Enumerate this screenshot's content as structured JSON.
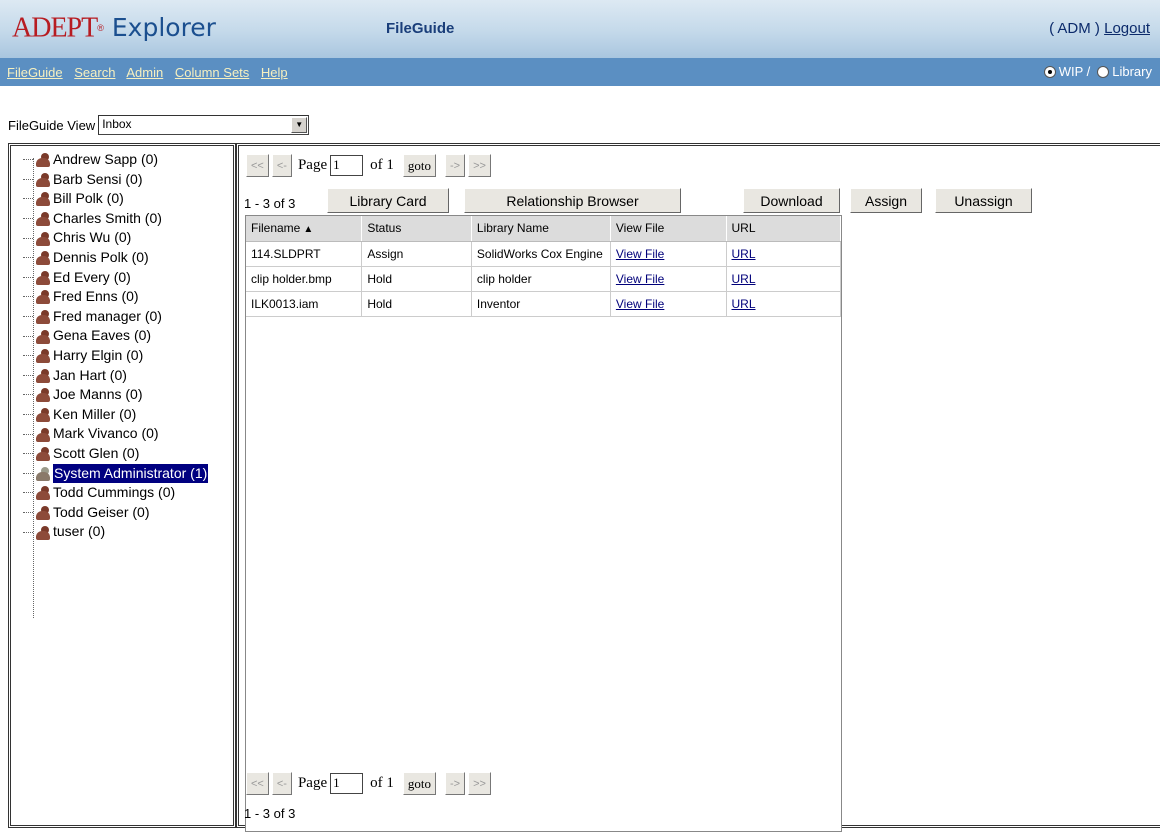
{
  "header": {
    "brand": "ADEPT",
    "trademark": "®",
    "product": "Explorer",
    "page_title": "FileGuide",
    "user_open": "( ",
    "user": "ADM",
    "user_close": " )",
    "logout": "Logout"
  },
  "menu": {
    "items": [
      "FileGuide",
      "Search",
      "Admin",
      "Column Sets",
      "Help"
    ],
    "mode_wip": "WIP /",
    "mode_library": "Library",
    "selected_mode": "WIP"
  },
  "view": {
    "label": "FileGuide View",
    "selected": "Inbox"
  },
  "users": [
    "Andrew Sapp (0)",
    "Barb Sensi (0)",
    "Bill Polk (0)",
    "Charles Smith (0)",
    "Chris Wu (0)",
    "Dennis Polk (0)",
    "Ed Every (0)",
    "Fred Enns (0)",
    "Fred manager (0)",
    "Gena Eaves (0)",
    "Harry Elgin (0)",
    "Jan Hart (0)",
    "Joe Manns (0)",
    "Ken Miller (0)",
    "Mark Vivanco (0)",
    "Scott Glen (0)",
    "System Administrator (1)",
    "Todd Cummings (0)",
    "Todd Geiser (0)",
    "tuser (0)"
  ],
  "selected_user": "System Administrator (1)",
  "pager": {
    "first": "<<",
    "prev": "<-",
    "page_label": "Page",
    "page_value": "1",
    "of_label": "of 1",
    "goto": "goto",
    "next": "->",
    "last": ">>",
    "count": "1 - 3 of 3"
  },
  "actions": {
    "library_card": "Library Card",
    "relationship_browser": "Relationship Browser",
    "download": "Download",
    "assign": "Assign",
    "unassign": "Unassign"
  },
  "table": {
    "columns": [
      "Filename",
      "Status",
      "Library Name",
      "View File",
      "URL"
    ],
    "sorted_column": "Filename",
    "rows": [
      [
        "114.SLDPRT",
        "Assign",
        "SolidWorks Cox Engine",
        "View File",
        "URL"
      ],
      [
        "clip holder.bmp",
        "Hold",
        "clip holder",
        "View File",
        "URL"
      ],
      [
        "ILK0013.iam",
        "Hold",
        "Inventor",
        "View File",
        "URL"
      ]
    ]
  },
  "colors": {
    "menu_bar": "#5b8fc2",
    "menu_link": "#f6f0c0",
    "brand_red": "#b71c22",
    "selection": "#000080"
  }
}
